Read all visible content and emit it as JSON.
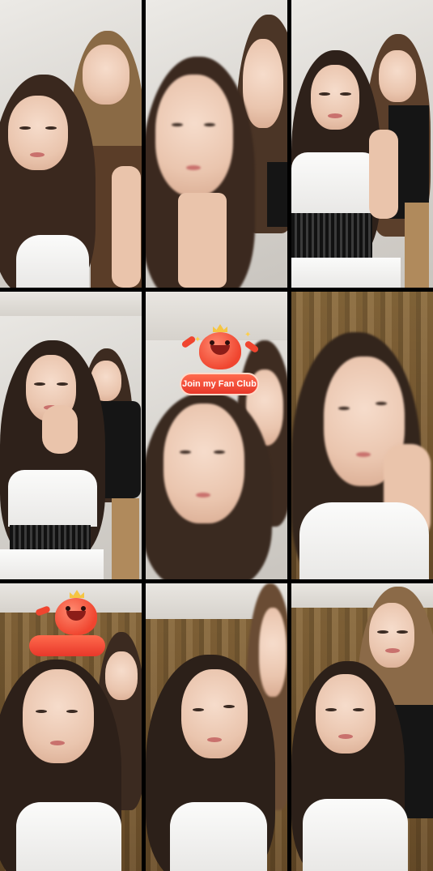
{
  "screen": {
    "tiles": [
      {
        "id": 1,
        "scene": "wall"
      },
      {
        "id": 2,
        "scene": "wall"
      },
      {
        "id": 3,
        "scene": "wall"
      },
      {
        "id": 4,
        "scene": "wall"
      },
      {
        "id": 5,
        "scene": "wall"
      },
      {
        "id": 6,
        "scene": "curtain"
      },
      {
        "id": 7,
        "scene": "curtain"
      },
      {
        "id": 8,
        "scene": "curtain"
      },
      {
        "id": 9,
        "scene": "curtain"
      }
    ]
  },
  "fan_club": {
    "label": "Join my Fan Club",
    "icon": "heart-mascot-icon",
    "accent": "#e8382a"
  },
  "colors": {
    "wall": "#d9d6d1",
    "curtain": "#7a5a30",
    "divider": "#000000"
  }
}
